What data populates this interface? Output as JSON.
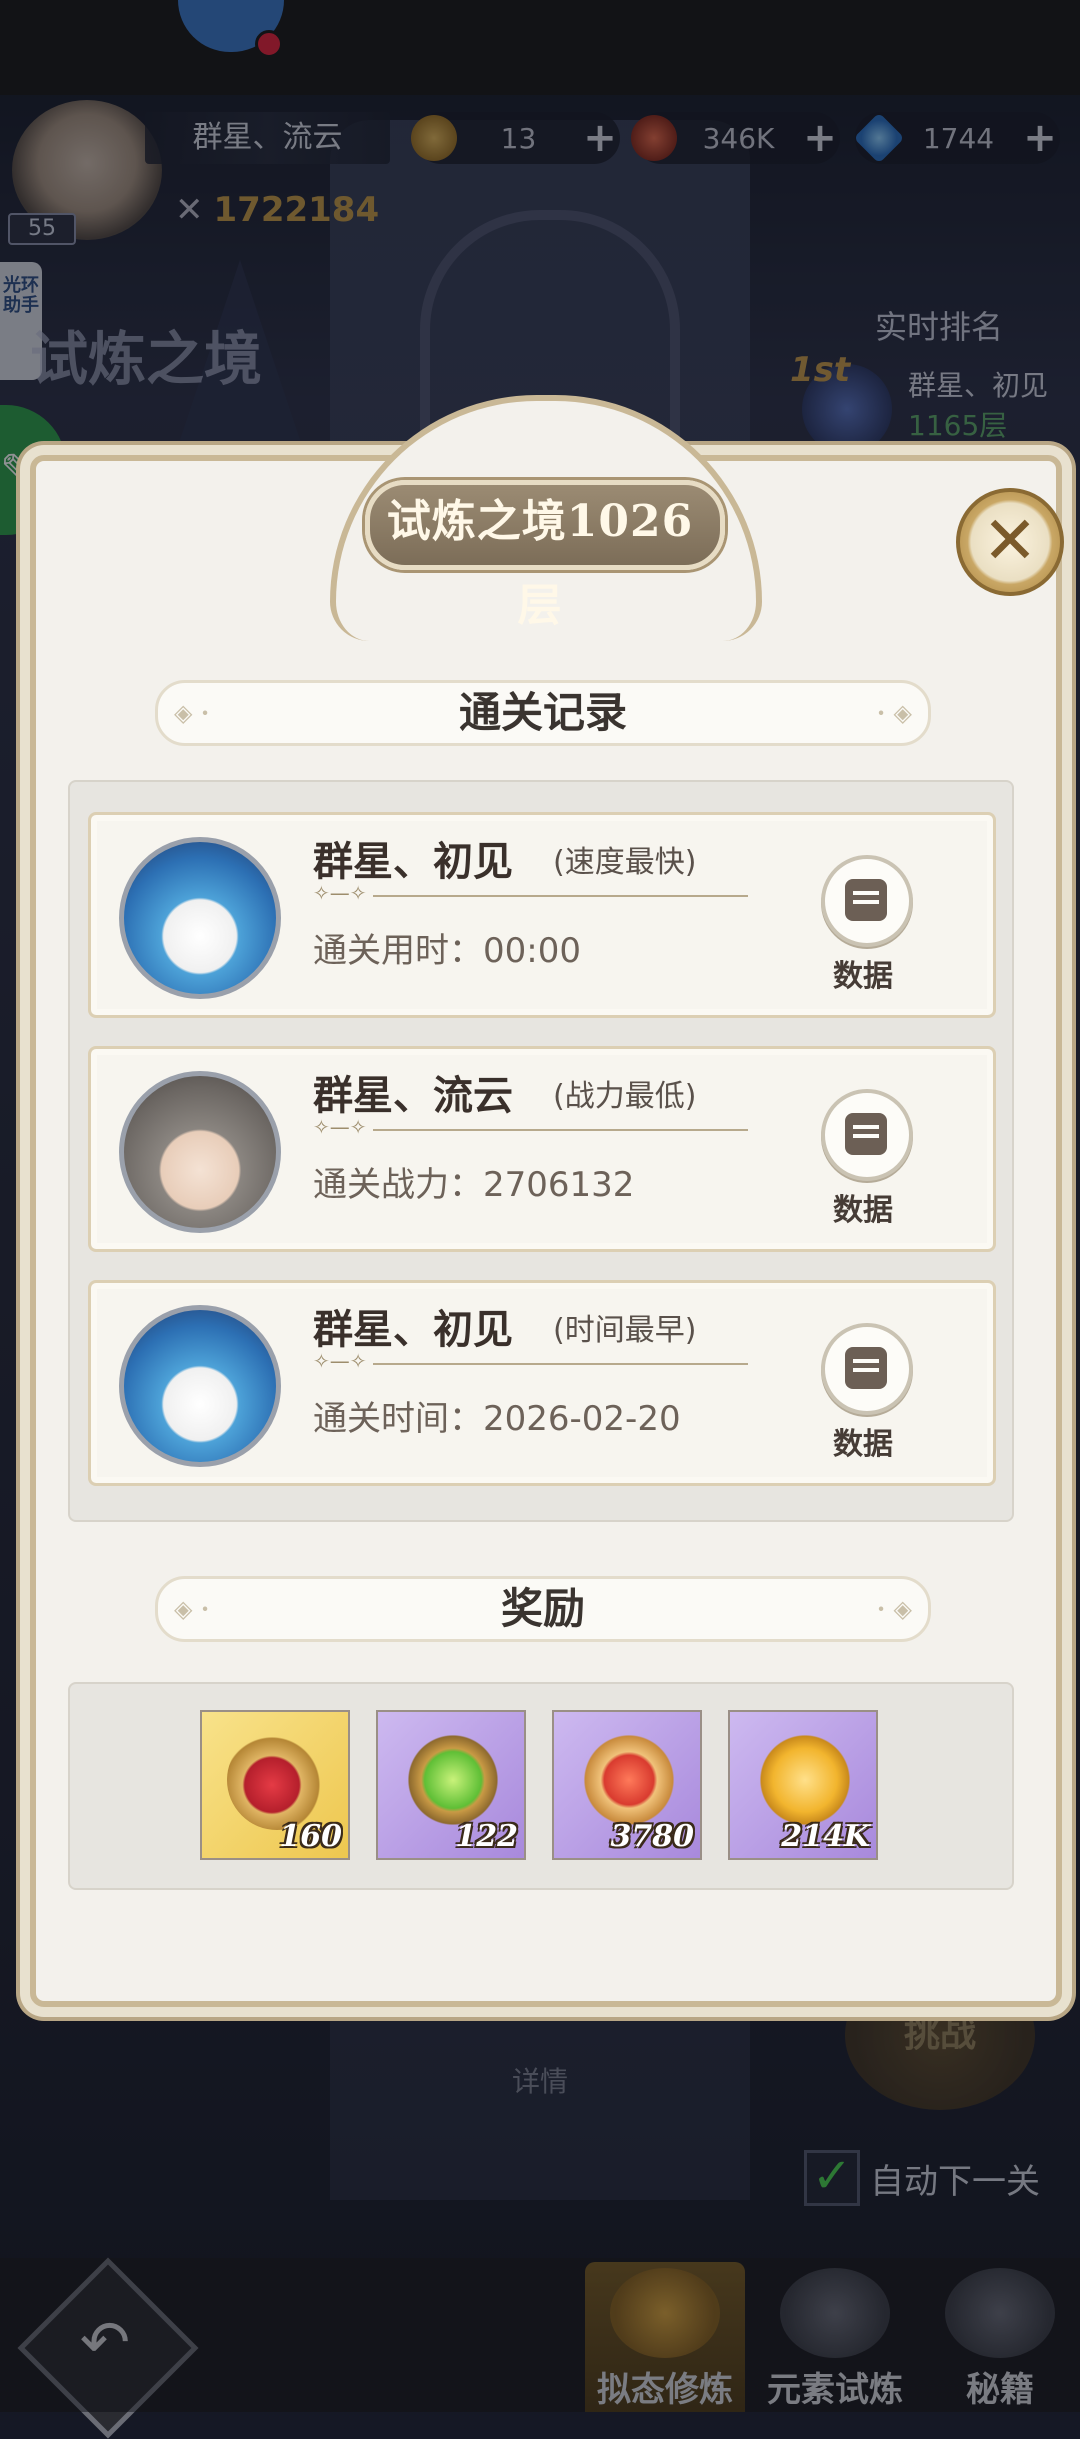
{
  "hud": {
    "player_name": "群星、流云",
    "player_level": "55",
    "combat_power": "1722184",
    "currencies": [
      {
        "icon": "gold-coin-icon",
        "value": "13",
        "color": "#c9a14a"
      },
      {
        "icon": "red-medallion-icon",
        "value": "346K",
        "color": "#c84432"
      },
      {
        "icon": "diamond-icon",
        "value": "1744",
        "color": "#4fa3e8"
      }
    ],
    "side_tab": "光环助手",
    "stage_title": "试炼之境",
    "realtime_rank_label": "实时排名",
    "rank_first": {
      "badge": "1st",
      "name": "群星、初见",
      "floor": "1165层"
    }
  },
  "modal": {
    "title": "试炼之境1026层",
    "records_title": "通关记录",
    "records": [
      {
        "name": "群星、初见",
        "tag": "(速度最快)",
        "stat": "通关用时：00:00",
        "data_label": "数据",
        "avatar": "bird"
      },
      {
        "name": "群星、流云",
        "tag": "(战力最低)",
        "stat": "通关战力：2706132",
        "data_label": "数据",
        "avatar": "girl"
      },
      {
        "name": "群星、初见",
        "tag": "(时间最早)",
        "stat": "通关时间：2026-02-20",
        "data_label": "数据",
        "avatar": "bird"
      }
    ],
    "rewards_title": "奖励",
    "rewards": [
      {
        "icon": "red-horn-icon",
        "count": "160",
        "bg": "gold"
      },
      {
        "icon": "green-gem-icon",
        "count": "122",
        "bg": "purple"
      },
      {
        "icon": "red-star-emblem-icon",
        "count": "3780",
        "bg": "purple"
      },
      {
        "icon": "gold-coin-icon",
        "count": "214K",
        "bg": "purple"
      }
    ]
  },
  "background": {
    "detail_label": "详情",
    "challenge_label": "挑战",
    "auto_next_label": "自动下一关",
    "bottom_tabs": [
      {
        "label": "拟态修炼",
        "active": true
      },
      {
        "label": "元素试炼",
        "active": false
      },
      {
        "label": "秘籍",
        "active": false
      }
    ]
  }
}
